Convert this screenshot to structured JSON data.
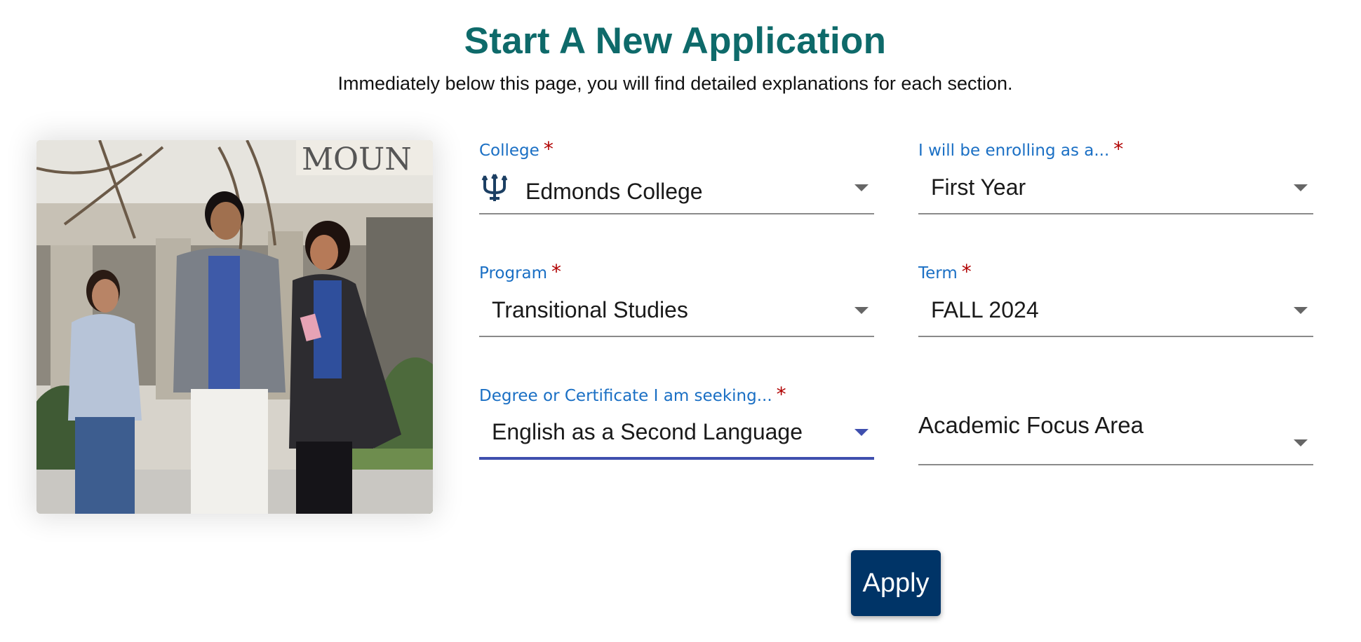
{
  "header": {
    "title": "Start A New Application",
    "subtitle": "Immediately below this page, you will find detailed explanations for each section."
  },
  "photo": {
    "sign_text": "MOUN",
    "icon": "students-walking-photo"
  },
  "form": {
    "college": {
      "label": "College",
      "required_mark": "*",
      "value": "Edmonds College",
      "icon": "trident-icon"
    },
    "enrolling_as": {
      "label": "I will be enrolling as a...",
      "required_mark": "*",
      "value": "First Year"
    },
    "program": {
      "label": "Program",
      "required_mark": "*",
      "value": "Transitional Studies"
    },
    "term": {
      "label": "Term",
      "required_mark": "*",
      "value": "FALL 2024"
    },
    "degree": {
      "label": "Degree or Certificate I am seeking...",
      "required_mark": "*",
      "value": "English as a Second Language"
    },
    "focus_area": {
      "placeholder": "Academic Focus Area"
    }
  },
  "actions": {
    "apply_label": "Apply"
  },
  "colors": {
    "title": "#0e6a6a",
    "label": "#1a6fc4",
    "required": "#b00000",
    "focus_underline": "#3f4fae",
    "apply_bg": "#003467"
  }
}
